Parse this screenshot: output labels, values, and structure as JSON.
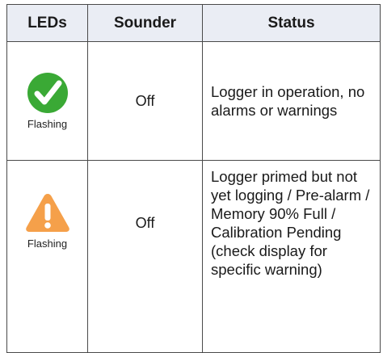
{
  "table": {
    "headers": {
      "leds": "LEDs",
      "sounder": "Sounder",
      "status": "Status"
    },
    "rows": [
      {
        "led_icon": "green-checkmark-icon",
        "led_caption": "Flashing",
        "led_color": "#3aa935",
        "sounder": "Off",
        "status": "Logger in operation, no alarms or warnings"
      },
      {
        "led_icon": "orange-warning-triangle-icon",
        "led_caption": "Flashing",
        "led_color": "#f5a04a",
        "sounder": "Off",
        "status": "Logger primed but not yet logging / Pre-alarm / Memory 90% Full / Calibration Pending (check display for specific warning)"
      }
    ]
  }
}
